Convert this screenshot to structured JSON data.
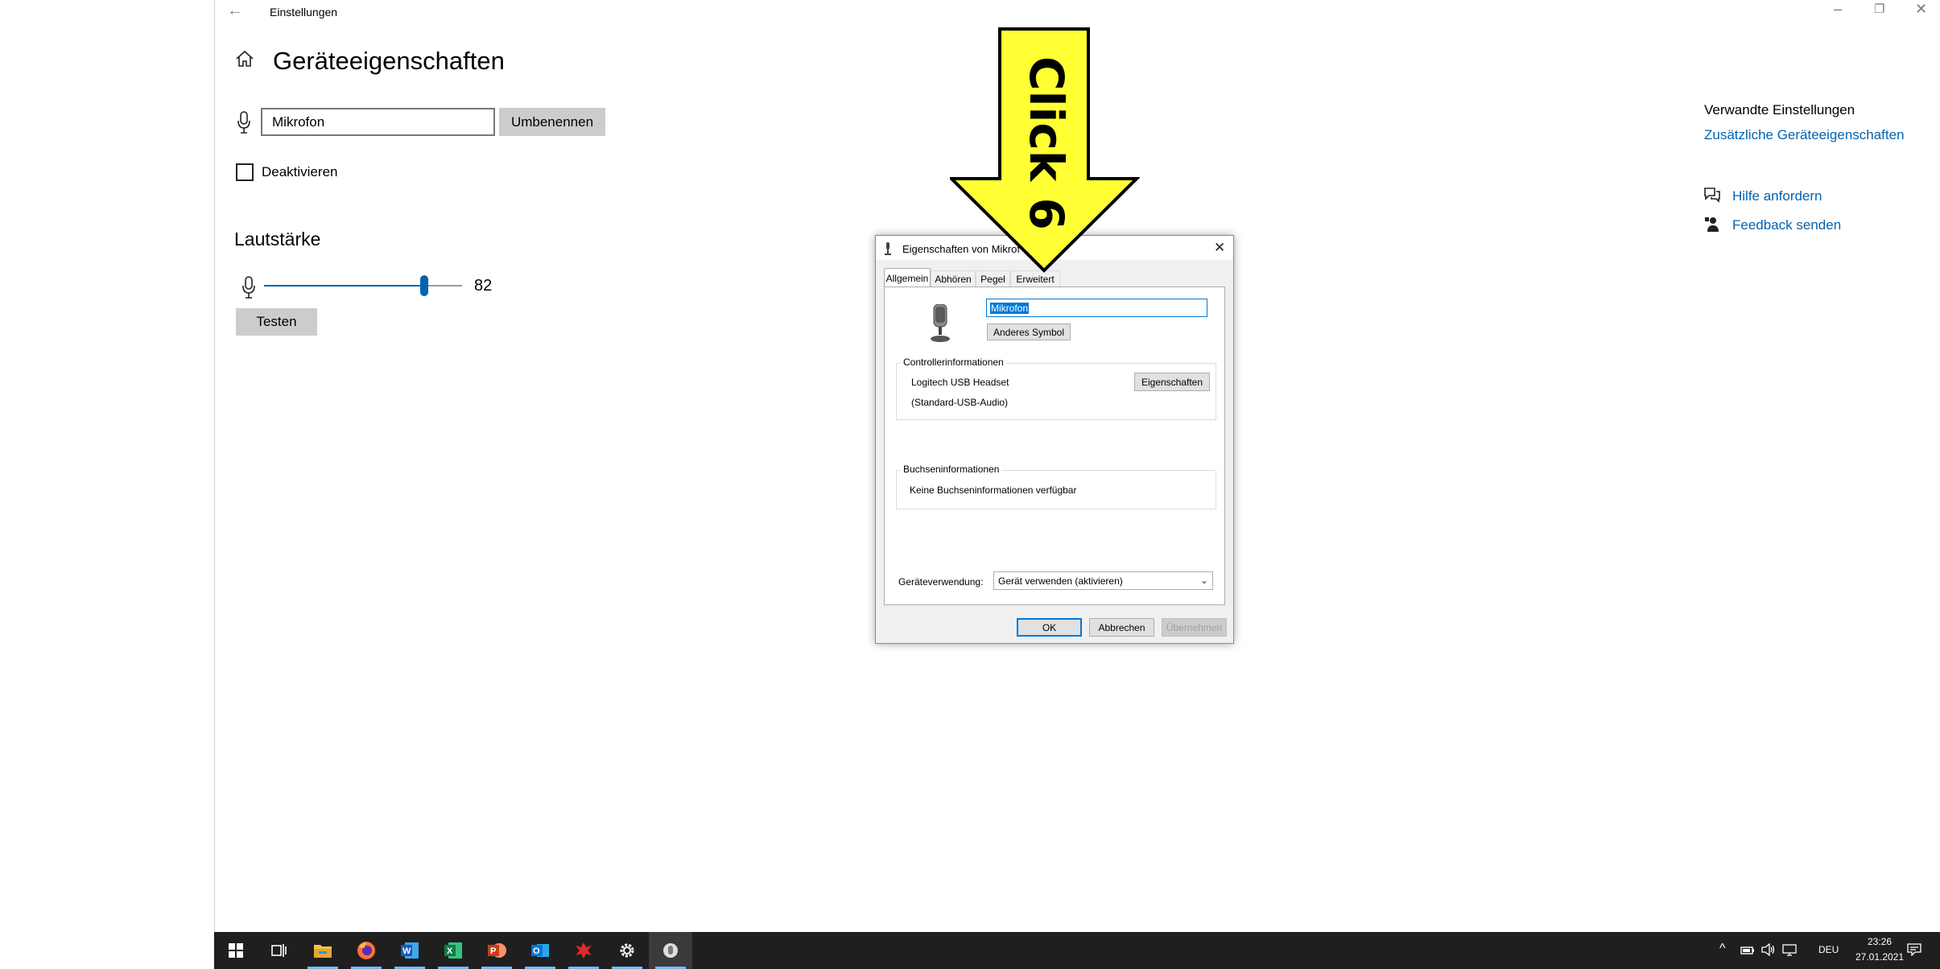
{
  "settings": {
    "window_title": "Einstellungen",
    "page_title": "Geräteeigenschaften",
    "device_name_value": "Mikrofon",
    "rename_button": "Umbenennen",
    "disable_label": "Deaktivieren",
    "disable_checked": false,
    "volume_title": "Lautstärke",
    "volume_value": "82",
    "volume_level": 82,
    "test_button": "Testen",
    "related_title": "Verwandte Einstellungen",
    "related_link": "Zusätzliche Geräteeigenschaften",
    "help_link": "Hilfe anfordern",
    "feedback_link": "Feedback senden"
  },
  "dialog": {
    "title": "Eigenschaften von Mikrof",
    "tabs": [
      "Allgemein",
      "Abhören",
      "Pegel",
      "Erweitert"
    ],
    "active_tab": "Allgemein",
    "name_value": "Mikrofon",
    "change_icon_button": "Anderes Symbol",
    "controller_group": "Controllerinformationen",
    "controller_name": "Logitech USB Headset",
    "controller_driver": "(Standard-USB-Audio)",
    "properties_button": "Eigenschaften",
    "jack_group": "Buchseninformationen",
    "jack_info": "Keine Buchseninformationen verfügbar",
    "usage_label": "Geräteverwendung:",
    "usage_value": "Gerät verwenden (aktivieren)",
    "ok_button": "OK",
    "cancel_button": "Abbrechen",
    "apply_button": "Übernehmen"
  },
  "annotation": {
    "text": "Click 6",
    "color": "#ffff33"
  },
  "taskbar": {
    "apps": [
      "start-icon",
      "task-view-icon",
      "file-explorer-icon",
      "firefox-icon",
      "word-icon",
      "excel-icon",
      "powerpoint-icon",
      "outlook-icon",
      "pdf-tool-icon",
      "settings-icon",
      "voice-recorder-icon"
    ],
    "language": "DEU",
    "time": "23:26",
    "date": "27.01.2021"
  },
  "colors": {
    "accent": "#0063b1",
    "taskbar": "#1f1f1f"
  }
}
